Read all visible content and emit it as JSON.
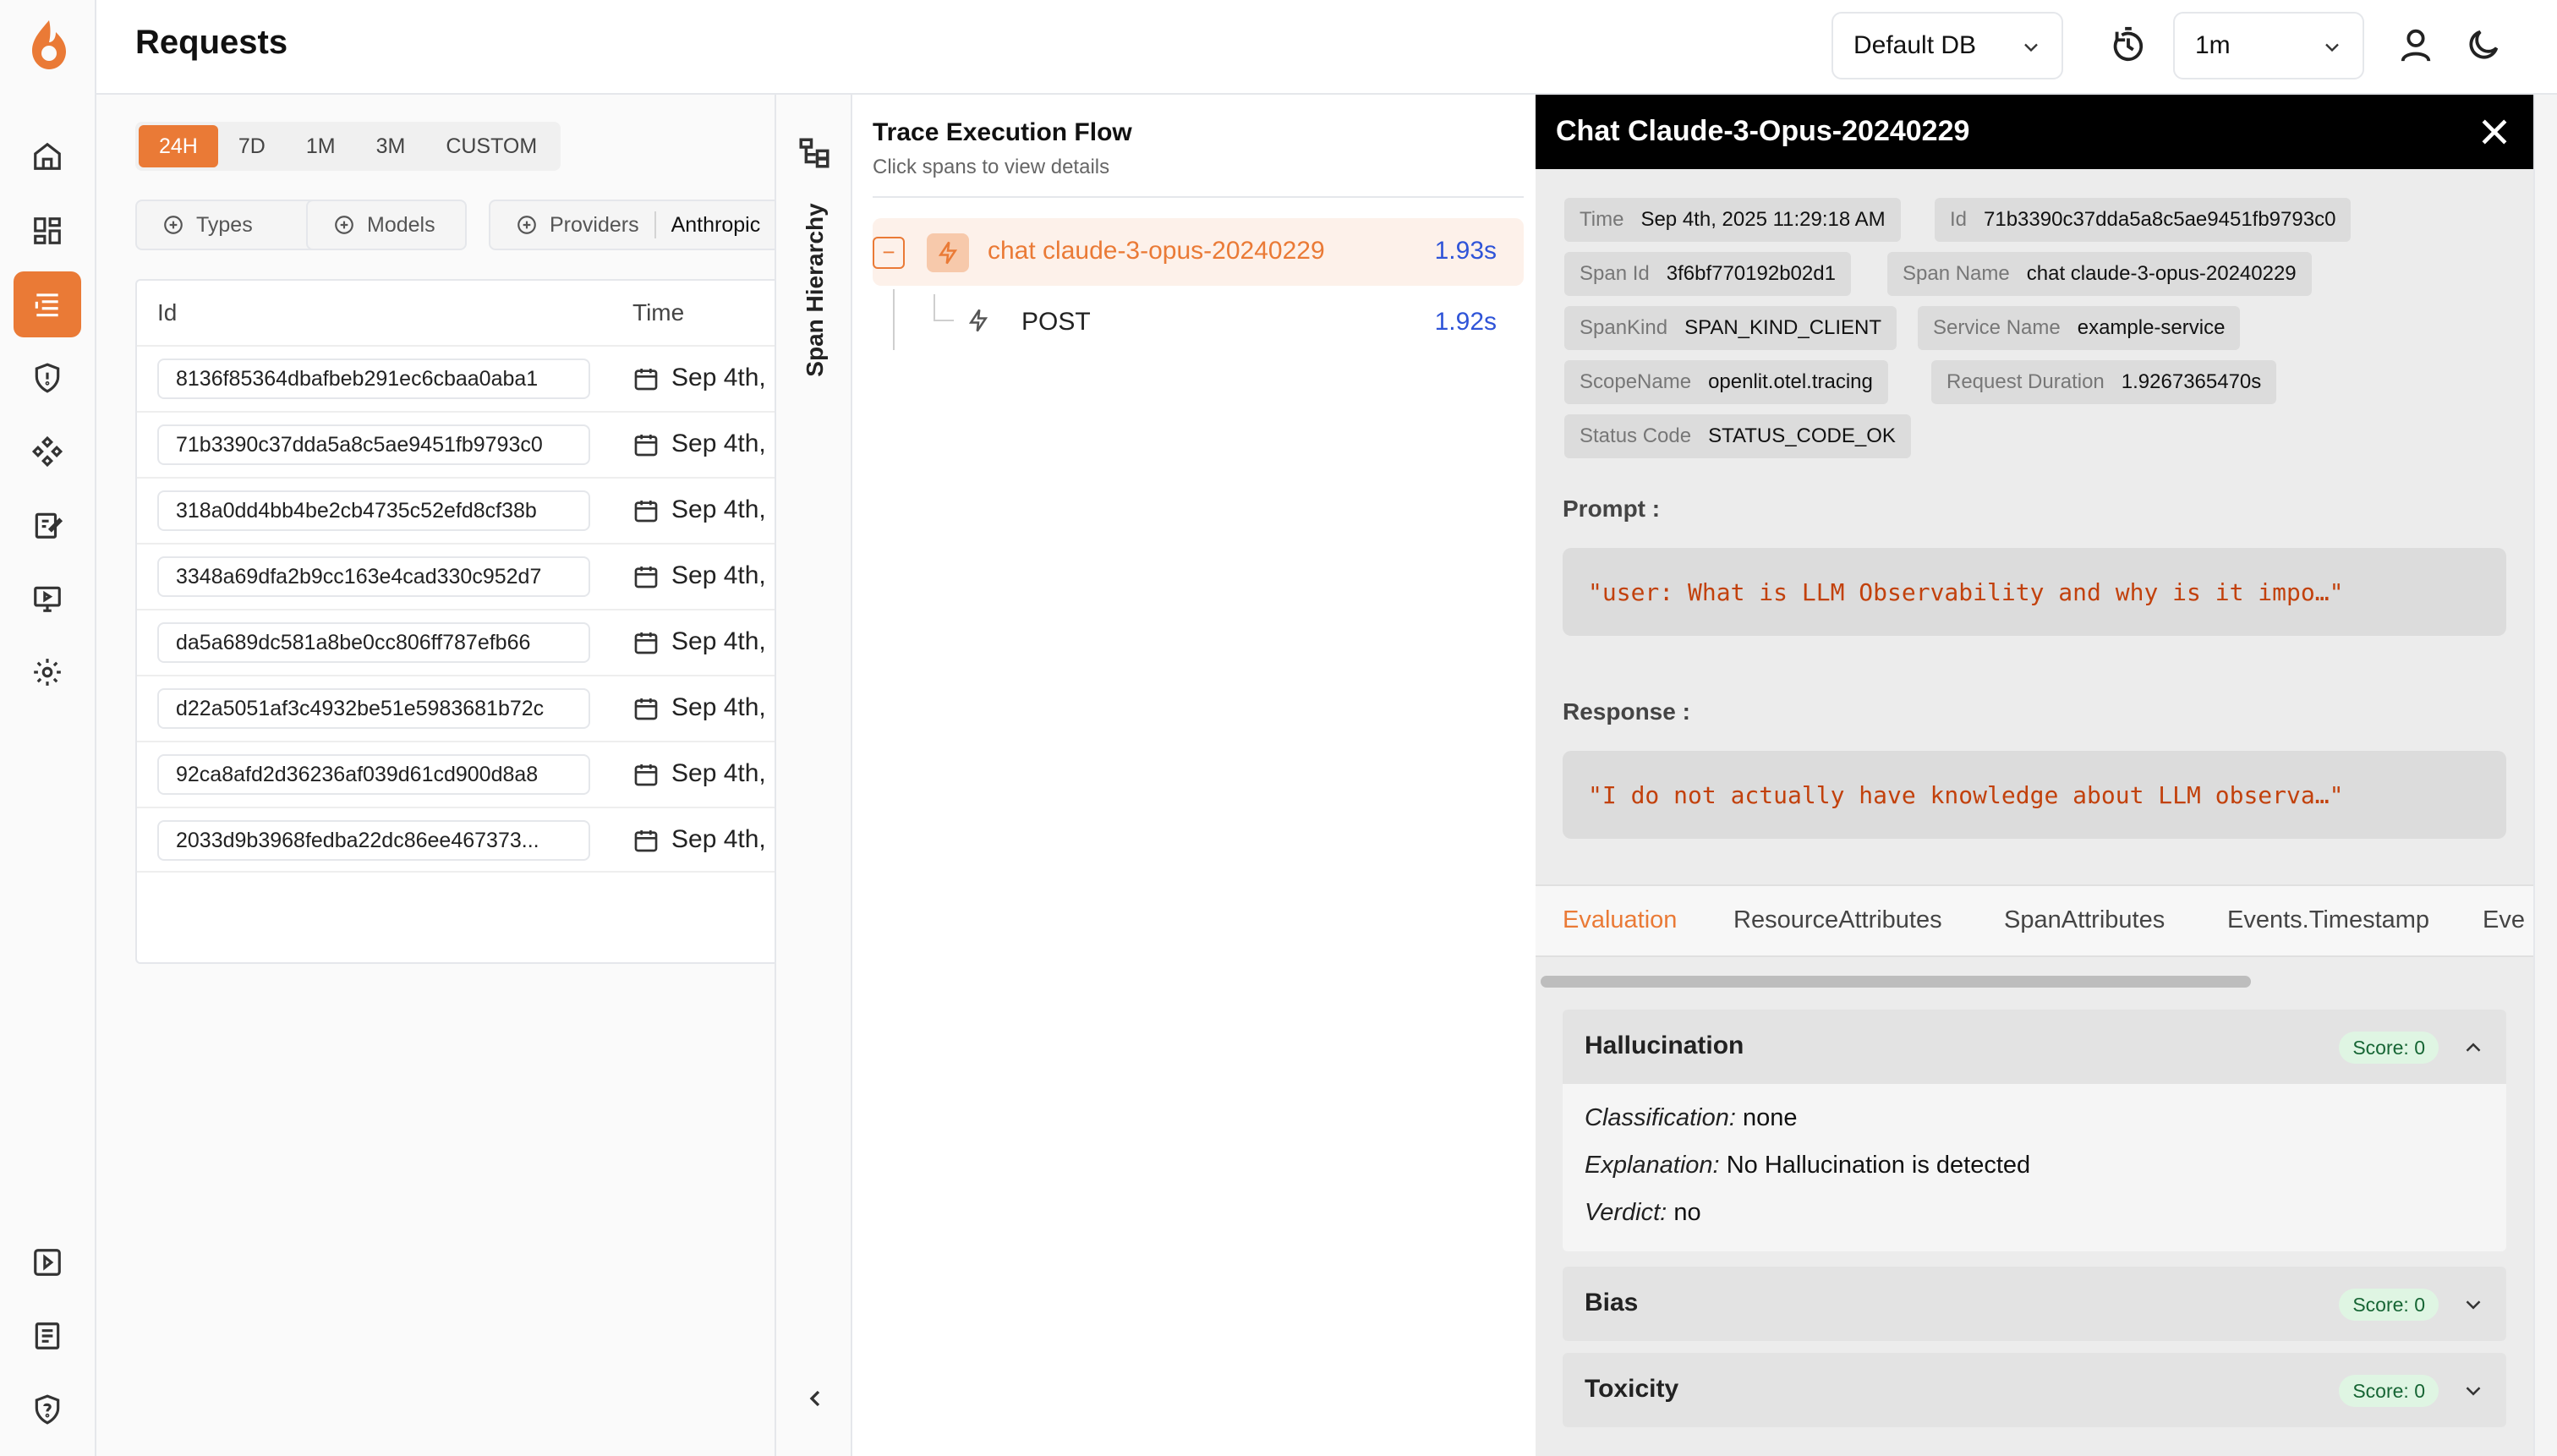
{
  "app": {
    "title": "Requests",
    "accent": "#ea7a36"
  },
  "rail": {
    "items": [
      {
        "icon": "home-icon",
        "active": false
      },
      {
        "icon": "dashboard-icon",
        "active": false
      },
      {
        "icon": "requests-list-icon",
        "active": true
      },
      {
        "icon": "shield-icon",
        "active": false
      },
      {
        "icon": "components-icon",
        "active": false
      },
      {
        "icon": "prompt-edit-icon",
        "active": false
      },
      {
        "icon": "monitor-play-icon",
        "active": false
      },
      {
        "icon": "settings-icon",
        "active": false
      }
    ],
    "bottom": [
      {
        "icon": "play-square-icon"
      },
      {
        "icon": "document-icon"
      },
      {
        "icon": "shield-question-icon"
      }
    ]
  },
  "header": {
    "db_select": "Default DB",
    "refresh_select": "1m",
    "icons": [
      "timer-refresh-icon",
      "user-icon",
      "moon-icon"
    ]
  },
  "requests": {
    "ranges": [
      "24H",
      "7D",
      "1M",
      "3M",
      "CUSTOM"
    ],
    "active_range": "24H",
    "filters": {
      "types": "Types",
      "models": "Models",
      "providers": "Providers",
      "providers_value": "Anthropic"
    },
    "columns": {
      "id": "Id",
      "time": "Time"
    },
    "rows": [
      {
        "id": "8136f85364dbafbeb291ec6cbaa0aba1",
        "time": "Sep 4th,"
      },
      {
        "id": "71b3390c37dda5a8c5ae9451fb9793c0",
        "time": "Sep 4th,"
      },
      {
        "id": "318a0dd4bb4be2cb4735c52efd8cf38b",
        "time": "Sep 4th,"
      },
      {
        "id": "3348a69dfa2b9cc163e4cad330c952d7",
        "time": "Sep 4th,"
      },
      {
        "id": "da5a689dc581a8be0cc806ff787efb66",
        "time": "Sep 4th,"
      },
      {
        "id": "d22a5051af3c4932be51e5983681b72c",
        "time": "Sep 4th,"
      },
      {
        "id": "92ca8afd2d36236af039d61cd900d8a8",
        "time": "Sep 4th,"
      },
      {
        "id": "2033d9b3968fedba22dc86ee467373...",
        "time": "Sep 4th,"
      }
    ]
  },
  "span_hierarchy": {
    "label": "Span Hierarchy"
  },
  "trace": {
    "title": "Trace Execution Flow",
    "subtitle": "Click spans to view details",
    "spans": [
      {
        "name": "chat claude-3-opus-20240229",
        "duration": "1.93s"
      },
      {
        "name": "POST",
        "duration": "1.92s"
      }
    ],
    "collapse_glyph": "−"
  },
  "detail": {
    "title": "Chat Claude-3-Opus-20240229",
    "attributes": [
      {
        "key": "Time",
        "value": "Sep 4th, 2025 11:29:18 AM"
      },
      {
        "key": "Id",
        "value": "71b3390c37dda5a8c5ae9451fb9793c0"
      },
      {
        "key": "Span Id",
        "value": "3f6bf770192b02d1"
      },
      {
        "key": "Span Name",
        "value": "chat claude-3-opus-20240229"
      },
      {
        "key": "SpanKind",
        "value": "SPAN_KIND_CLIENT"
      },
      {
        "key": "Service Name",
        "value": "example-service"
      },
      {
        "key": "ScopeName",
        "value": "openlit.otel.tracing"
      },
      {
        "key": "Request Duration",
        "value": "1.9267365470s"
      },
      {
        "key": "Status Code",
        "value": "STATUS_CODE_OK"
      }
    ],
    "prompt_label": "Prompt :",
    "prompt": "\"user: What is LLM Observability and why is it impo…\"",
    "response_label": "Response :",
    "response": "\"I do not actually have knowledge about LLM observa…\"",
    "tabs": [
      "Evaluation",
      "ResourceAttributes",
      "SpanAttributes",
      "Events.Timestamp",
      "Eve"
    ],
    "active_tab": "Evaluation",
    "evaluations": [
      {
        "name": "Hallucination",
        "score": "Score: 0",
        "expanded": true,
        "classification_label": "Classification:",
        "classification": "none",
        "explanation_label": "Explanation:",
        "explanation": "No Hallucination is detected",
        "verdict_label": "Verdict:",
        "verdict": "no"
      },
      {
        "name": "Bias",
        "score": "Score: 0",
        "expanded": false
      },
      {
        "name": "Toxicity",
        "score": "Score: 0",
        "expanded": false
      }
    ]
  }
}
